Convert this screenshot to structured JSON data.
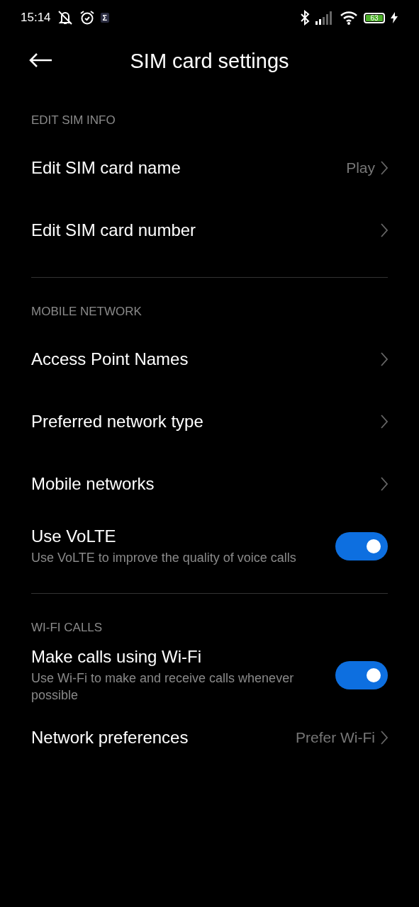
{
  "status_bar": {
    "time": "15:14",
    "app_badge": "Σ",
    "battery": "63"
  },
  "header": {
    "title": "SIM card settings"
  },
  "sections": [
    {
      "title": "EDIT SIM INFO",
      "items": [
        {
          "kind": "link",
          "label": "Edit SIM card name",
          "value": "Play"
        },
        {
          "kind": "link",
          "label": "Edit SIM card number"
        }
      ]
    },
    {
      "title": "MOBILE NETWORK",
      "items": [
        {
          "kind": "link",
          "label": "Access Point Names"
        },
        {
          "kind": "link",
          "label": "Preferred network type"
        },
        {
          "kind": "link",
          "label": "Mobile networks"
        },
        {
          "kind": "toggle",
          "label": "Use VoLTE",
          "description": "Use VoLTE to improve the quality of voice calls",
          "on": true
        }
      ]
    },
    {
      "title": "WI-FI CALLS",
      "items": [
        {
          "kind": "toggle",
          "label": "Make calls using Wi-Fi",
          "description": "Use Wi-Fi to make and receive calls whenever possible",
          "on": true
        },
        {
          "kind": "link",
          "label": "Network preferences",
          "value": "Prefer Wi-Fi"
        }
      ]
    }
  ]
}
